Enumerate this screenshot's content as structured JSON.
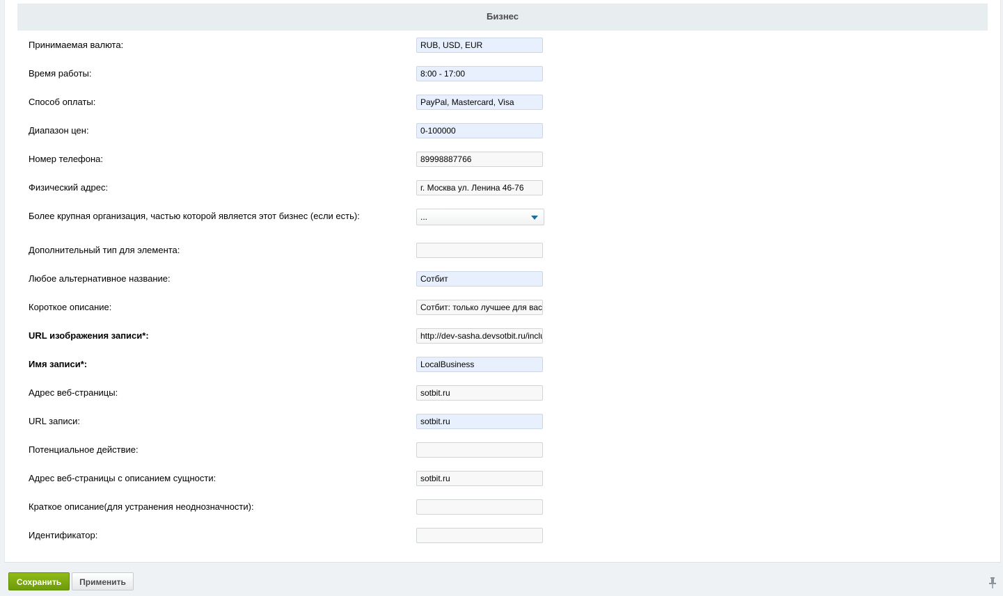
{
  "section": {
    "title": "Бизнес"
  },
  "fields": [
    {
      "label": "Принимаемая валюта:",
      "value": "RUB, USD, EUR",
      "type": "text",
      "style": "blue",
      "required": false
    },
    {
      "label": "Время работы:",
      "value": "8:00 - 17:00",
      "type": "text",
      "style": "blue",
      "required": false
    },
    {
      "label": "Способ оплаты:",
      "value": "PayPal, Mastercard, Visa",
      "type": "text",
      "style": "blue",
      "required": false
    },
    {
      "label": "Диапазон цен:",
      "value": "0-100000",
      "type": "text",
      "style": "blue",
      "required": false
    },
    {
      "label": "Номер телефона:",
      "value": "89998887766",
      "type": "text",
      "style": "plain",
      "required": false
    },
    {
      "label": "Физический адрес:",
      "value": "г. Москва ул. Ленина 46-76",
      "type": "text",
      "style": "plain",
      "required": false
    },
    {
      "label": "Более крупная организация, частью которой является этот бизнес (если есть):",
      "value": "...",
      "type": "select",
      "style": "plain",
      "required": false
    },
    {
      "label": "Дополнительный тип для элемента:",
      "value": "",
      "type": "text",
      "style": "plain",
      "required": false
    },
    {
      "label": "Любое альтернативное название:",
      "value": "Сотбит",
      "type": "text",
      "style": "blue",
      "required": false
    },
    {
      "label": "Короткое описание:",
      "value": "Сотбит: только лучшее для вас.",
      "type": "text",
      "style": "plain",
      "required": false
    },
    {
      "label": "URL изображения записи*:",
      "value": "http://dev-sasha.devsotbit.ru/inclu",
      "type": "text",
      "style": "plain",
      "required": true
    },
    {
      "label": "Имя записи*:",
      "value": "LocalBusiness",
      "type": "text",
      "style": "blue",
      "required": true
    },
    {
      "label": "Адрес веб-страницы:",
      "value": "sotbit.ru",
      "type": "text",
      "style": "plain",
      "required": false
    },
    {
      "label": "URL записи:",
      "value": "sotbit.ru",
      "type": "text",
      "style": "blue",
      "required": false
    },
    {
      "label": "Потенциальное действие:",
      "value": "",
      "type": "text",
      "style": "plain",
      "required": false
    },
    {
      "label": "Адрес веб-страницы с описанием сущности:",
      "value": "sotbit.ru",
      "type": "text",
      "style": "plain",
      "required": false
    },
    {
      "label": "Краткое описание(для устранения неоднозначности):",
      "value": "",
      "type": "text",
      "style": "plain",
      "required": false
    },
    {
      "label": "Идентификатор:",
      "value": "",
      "type": "text",
      "style": "plain",
      "required": false
    }
  ],
  "buttons": {
    "save_label": "Сохранить",
    "apply_label": "Применить"
  },
  "icons": {
    "pin": "pin-icon",
    "dropdown": "chevron-down-icon"
  },
  "colors": {
    "save_button": "#7ba70f",
    "filled_field": "#e8f0fe",
    "header_bg": "#e8edef"
  }
}
